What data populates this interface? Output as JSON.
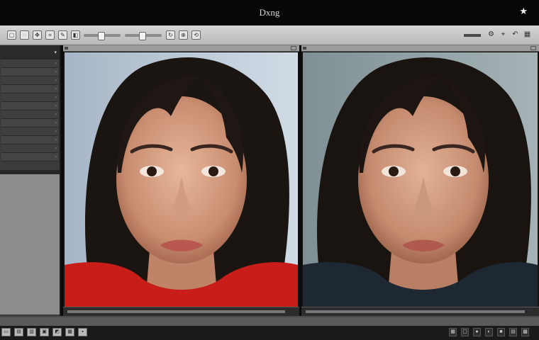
{
  "window": {
    "title": "Dxng",
    "pin_icon": "star-icon"
  },
  "toolbar": {
    "left_text": "",
    "buttons": [
      "",
      "",
      "",
      "",
      "",
      "",
      "",
      ""
    ],
    "right_icons": [
      "gear-icon",
      "crosshair-icon",
      "undo-icon",
      "grid-icon"
    ]
  },
  "sidebar": {
    "header": "",
    "rows": [
      "",
      "",
      "",
      "",
      "",
      "",
      "",
      "",
      "",
      "",
      "",
      ""
    ]
  },
  "left_pane": {
    "header": ""
  },
  "right_pane": {
    "header": ""
  },
  "statusbar": {
    "top_label": "",
    "tab_label": ""
  },
  "colors": {
    "accent": "#9b9b9b",
    "shirt_left": "#c81d18",
    "shirt_right": "#1e2833"
  }
}
